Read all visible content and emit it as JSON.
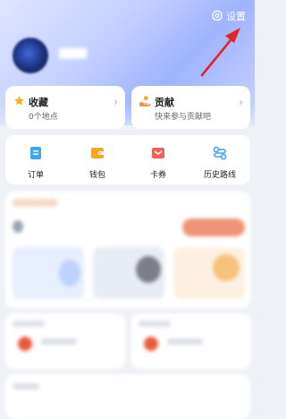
{
  "header": {
    "settings_label": "设置",
    "settings_icon": "gear-icon"
  },
  "favorites": {
    "title": "收藏",
    "subtitle": "0个地点",
    "icon": "star-icon"
  },
  "contribute": {
    "title": "贡献",
    "subtitle": "快来参与贡献吧",
    "icon": "hand-icon"
  },
  "quick_actions": [
    {
      "label": "订单",
      "icon": "order-icon",
      "color": "#3fa4f4"
    },
    {
      "label": "钱包",
      "icon": "wallet-icon",
      "color": "#f5a623"
    },
    {
      "label": "卡券",
      "icon": "coupon-icon",
      "color": "#f0615a"
    },
    {
      "label": "历史路线",
      "icon": "route-icon",
      "color": "#3fa4f4"
    }
  ],
  "colors": {
    "accent_arrow": "#e0271f",
    "hero_gradient": "#9fb4ff"
  }
}
